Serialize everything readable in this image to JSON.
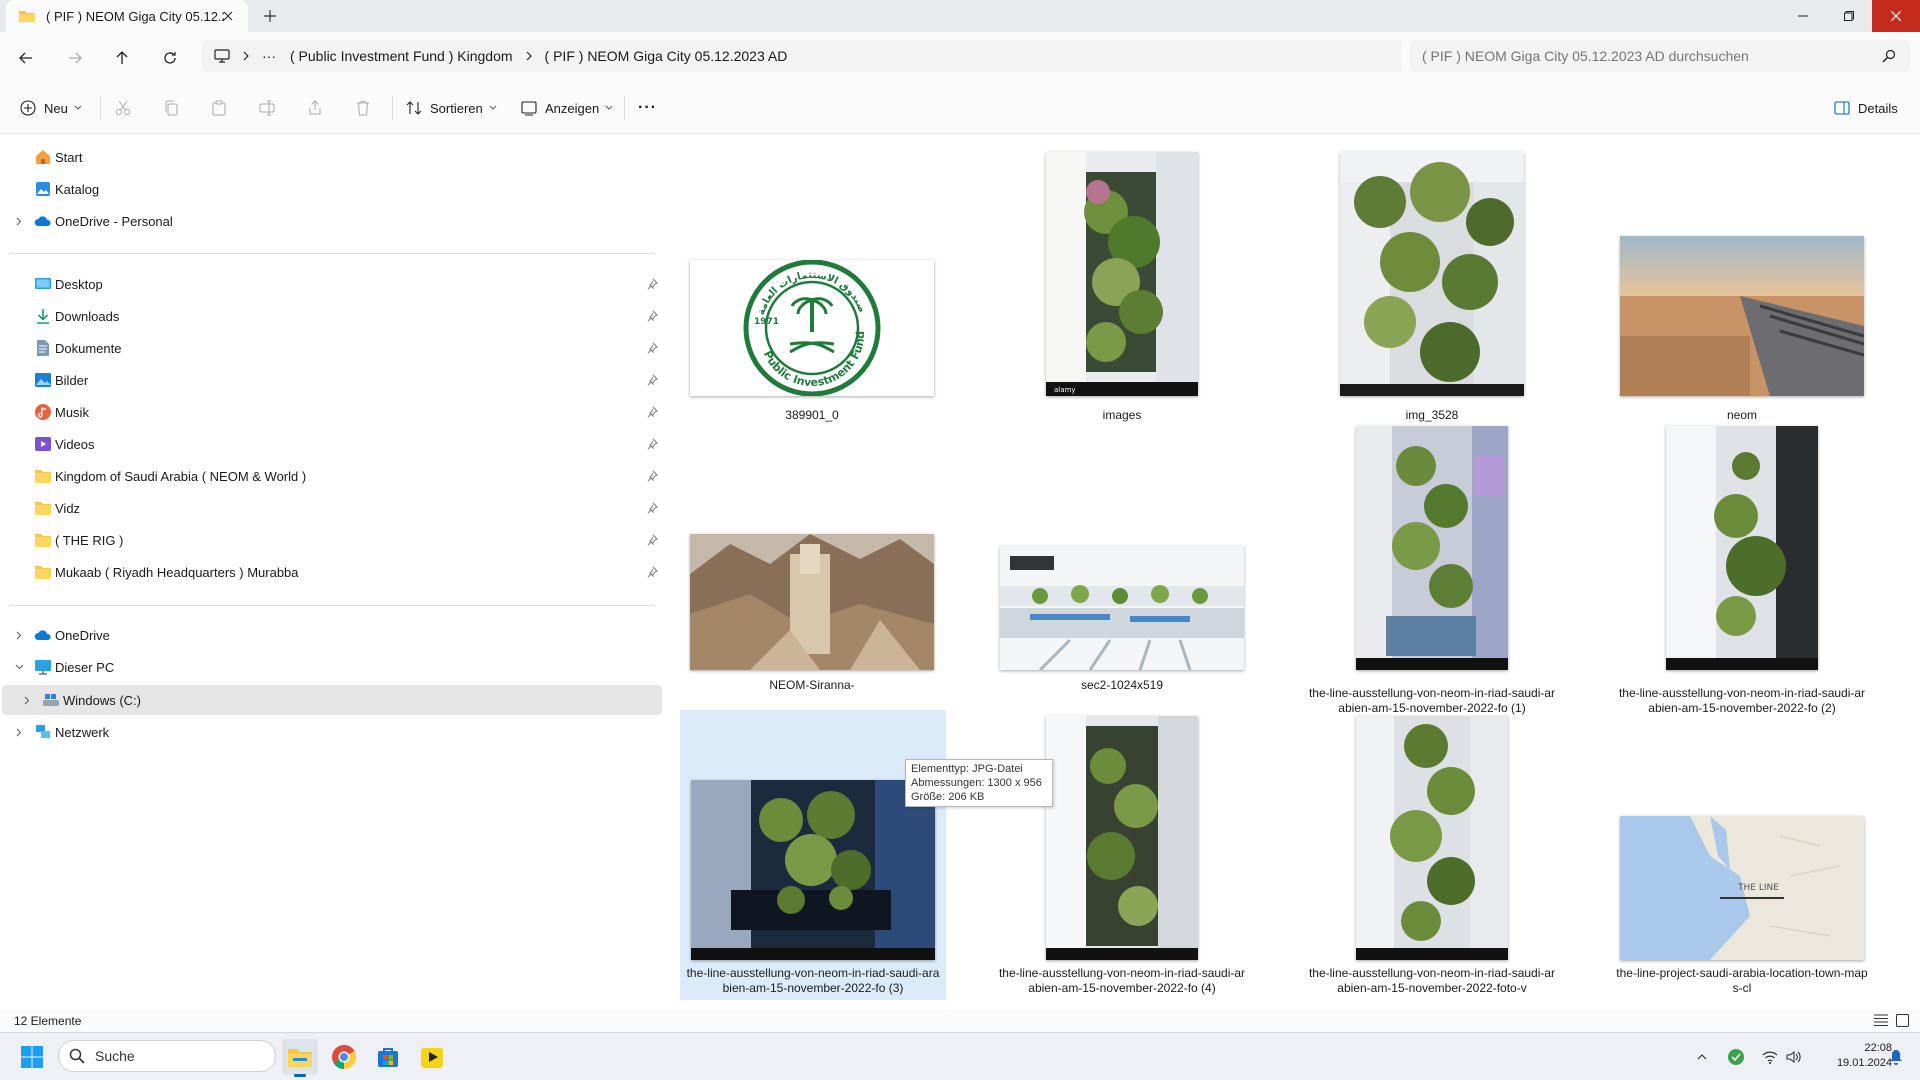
{
  "window": {
    "tab_title": "( PIF ) NEOM Giga City 05.12.2",
    "new_tab_symbol": "+",
    "colors": {
      "accent": "#0067c0",
      "folder": "#f4c44e",
      "selection": "#dcebfa"
    }
  },
  "address": {
    "more_symbol": "···",
    "crumbs": [
      "( Public Investment Fund ) Kingdom",
      "( PIF ) NEOM Giga City 05.12.2023 AD"
    ],
    "search_placeholder": "( PIF ) NEOM Giga City 05.12.2023 AD durchsuchen"
  },
  "toolbar": {
    "new_label": "Neu",
    "sort_label": "Sortieren",
    "view_label": "Anzeigen",
    "more_symbol": "···",
    "details_label": "Details"
  },
  "sidebar": {
    "top": [
      {
        "label": "Start",
        "icon": "home-icon"
      },
      {
        "label": "Katalog",
        "icon": "gallery-icon"
      },
      {
        "label": "OneDrive - Personal",
        "icon": "cloud-icon"
      }
    ],
    "pinned": [
      {
        "label": "Desktop",
        "icon": "desktop-icon"
      },
      {
        "label": "Downloads",
        "icon": "download-icon"
      },
      {
        "label": "Dokumente",
        "icon": "document-icon"
      },
      {
        "label": "Bilder",
        "icon": "pictures-icon"
      },
      {
        "label": "Musik",
        "icon": "music-icon"
      },
      {
        "label": "Videos",
        "icon": "video-icon"
      },
      {
        "label": "Kingdom of Saudi Arabia ( NEOM & World  )",
        "icon": "folder-icon"
      },
      {
        "label": "Vidz",
        "icon": "folder-icon"
      },
      {
        "label": "( THE RIG )",
        "icon": "folder-icon"
      },
      {
        "label": "Mukaab ( Riyadh Headquarters ) Murabba",
        "icon": "folder-icon"
      }
    ],
    "bottom": [
      {
        "label": "OneDrive",
        "icon": "cloud-icon"
      },
      {
        "label": "Dieser PC",
        "icon": "pc-icon"
      },
      {
        "label": "Windows (C:)",
        "icon": "drive-icon"
      },
      {
        "label": "Netzwerk",
        "icon": "network-icon"
      }
    ]
  },
  "files": [
    {
      "name": "389901_0",
      "kind": "logo"
    },
    {
      "name": "images",
      "kind": "portrait"
    },
    {
      "name": "img_3528",
      "kind": "portrait"
    },
    {
      "name": "neom",
      "kind": "landscape-desert"
    },
    {
      "name": "NEOM-Siranna-",
      "kind": "landscape-mountain"
    },
    {
      "name": "sec2-1024x519",
      "kind": "landscape-render"
    },
    {
      "name": "the-line-ausstellung-von-neom-in-riad-saudi-arabien-am-15-november-2022-fo (1)",
      "kind": "portrait"
    },
    {
      "name": "the-line-ausstellung-von-neom-in-riad-saudi-arabien-am-15-november-2022-fo (2)",
      "kind": "portrait"
    },
    {
      "name": "the-line-ausstellung-von-neom-in-riad-saudi-arabien-am-15-november-2022-fo (3)",
      "kind": "landscape-green"
    },
    {
      "name": "the-line-ausstellung-von-neom-in-riad-saudi-arabien-am-15-november-2022-fo (4)",
      "kind": "portrait"
    },
    {
      "name": "the-line-ausstellung-von-neom-in-riad-saudi-arabien-am-15-november-2022-foto-v",
      "kind": "portrait"
    },
    {
      "name": "the-line-project-saudi-arabia-location-town-maps-cl",
      "kind": "landscape-map"
    }
  ],
  "logo_text": {
    "top": "صندوق الاستثمارات العامة",
    "bottom": "Public Investment Fund",
    "year": "1971"
  },
  "map_label": "THE LINE",
  "watermark": "alamy",
  "tooltip": {
    "line1": "Elementtyp: JPG-Datei",
    "line2": "Abmessungen: 1300 x 956",
    "line3": "Größe: 206 KB"
  },
  "status": {
    "count": "12 Elemente"
  },
  "taskbar": {
    "search_label": "Suche",
    "time": "22:08",
    "date": "19.01.2024"
  }
}
